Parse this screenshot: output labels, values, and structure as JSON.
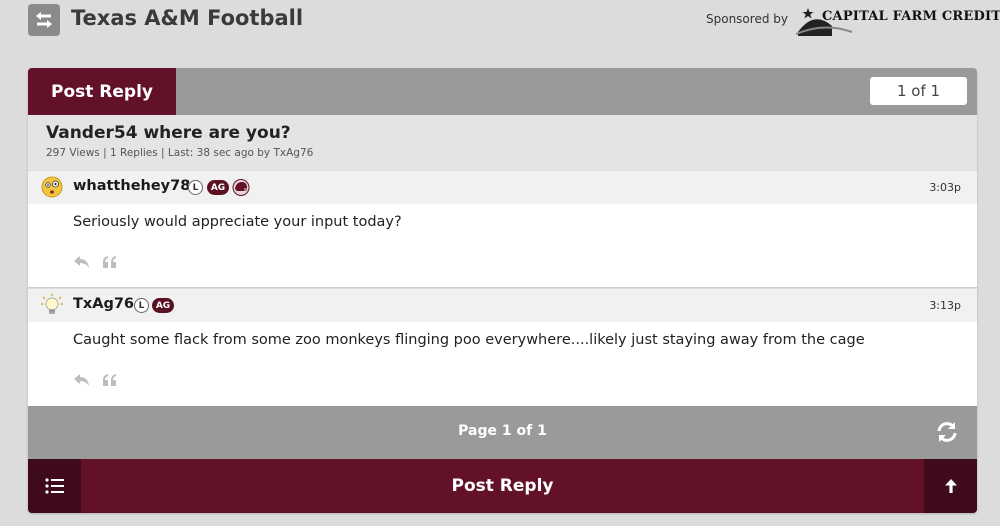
{
  "header": {
    "board_title": "Texas A&M Football",
    "sponsored_by_label": "Sponsored by",
    "sponsor_name": "CAPITAL FARM CREDIT"
  },
  "thread": {
    "post_reply_label": "Post Reply",
    "page_indicator": "1 of 1",
    "title": "Vander54 where are you?",
    "meta": "297 Views | 1 Replies | Last: 38 sec ago by TxAg76"
  },
  "posts": [
    {
      "username": "whatthehey78",
      "badge_l": "L",
      "badge_ag": "AG",
      "time": "3:03p",
      "text": "Seriously would appreciate your input today?"
    },
    {
      "username": "TxAg76",
      "badge_l": "L",
      "badge_ag": "AG",
      "time": "3:13p",
      "text": "Caught some flack from some zoo monkeys flinging poo everywhere....likely just staying away from the cage"
    }
  ],
  "pager": {
    "label": "Page 1 of 1"
  },
  "footer": {
    "post_reply_label": "Post Reply"
  },
  "colors": {
    "maroon": "#621129",
    "dark_maroon": "#3f0b1a",
    "gray_bar": "#9a9a9a"
  }
}
